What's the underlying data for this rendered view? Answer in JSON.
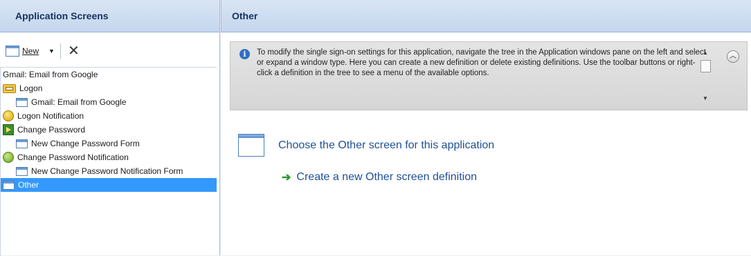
{
  "left_pane": {
    "title": "Application Screens",
    "toolbar": {
      "new_label": "New",
      "delete_icon": "close-icon"
    },
    "tree": [
      {
        "label": "Gmail: Email from Google",
        "level": 0,
        "icon": "none"
      },
      {
        "label": "Logon",
        "level": 0,
        "icon": "logon-icon"
      },
      {
        "label": "Gmail: Email from Google",
        "level": 1,
        "icon": "window-icon"
      },
      {
        "label": "Logon Notification",
        "level": 0,
        "icon": "notification-icon"
      },
      {
        "label": "Change Password",
        "level": 0,
        "icon": "change-password-icon"
      },
      {
        "label": "New Change Password Form",
        "level": 1,
        "icon": "window-icon"
      },
      {
        "label": "Change Password Notification",
        "level": 0,
        "icon": "notification-icon"
      },
      {
        "label": "New Change Password Notification Form",
        "level": 1,
        "icon": "window-icon"
      },
      {
        "label": "Other",
        "level": 0,
        "icon": "window-icon",
        "selected": true
      }
    ]
  },
  "right_pane": {
    "title": "Other",
    "info_text": "To modify the single sign-on settings for this application, navigate the tree in the Application windows pane on the left and select or expand a window type. Here you can create a new definition or delete existing definitions. Use the toolbar buttons or right-click a definition in the tree to see a menu of the available options.",
    "choose_text": "Choose the Other screen for this application",
    "create_link": "Create a new Other screen definition"
  },
  "colors": {
    "selection": "#3399ff",
    "header": "#c4d6ee",
    "link": "#1f4f96"
  }
}
